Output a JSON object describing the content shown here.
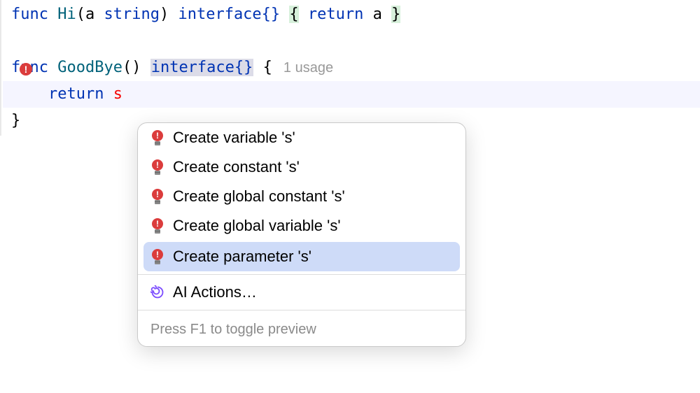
{
  "code": {
    "line1": {
      "func": "func",
      "name": "Hi",
      "paramOpen": "(",
      "paramName": "a",
      "paramType": "string",
      "paramClose": ")",
      "retType": "interface{}",
      "braceOpen": "{",
      "ret": "return",
      "retVal": "a",
      "braceClose": "}"
    },
    "line3": {
      "func": "func",
      "name": "GoodBye",
      "parens": "()",
      "retType": "interface{}",
      "braceOpen": "{",
      "usageHint": "1 usage"
    },
    "line4": {
      "ret": "return",
      "retVal": "s"
    },
    "line5": {
      "braceClose": "}"
    }
  },
  "popup": {
    "items": [
      "Create variable 's'",
      "Create constant 's'",
      "Create global constant 's'",
      "Create global variable 's'",
      "Create parameter 's'"
    ],
    "aiActions": "AI Actions…",
    "footer": "Press F1 to toggle preview"
  }
}
